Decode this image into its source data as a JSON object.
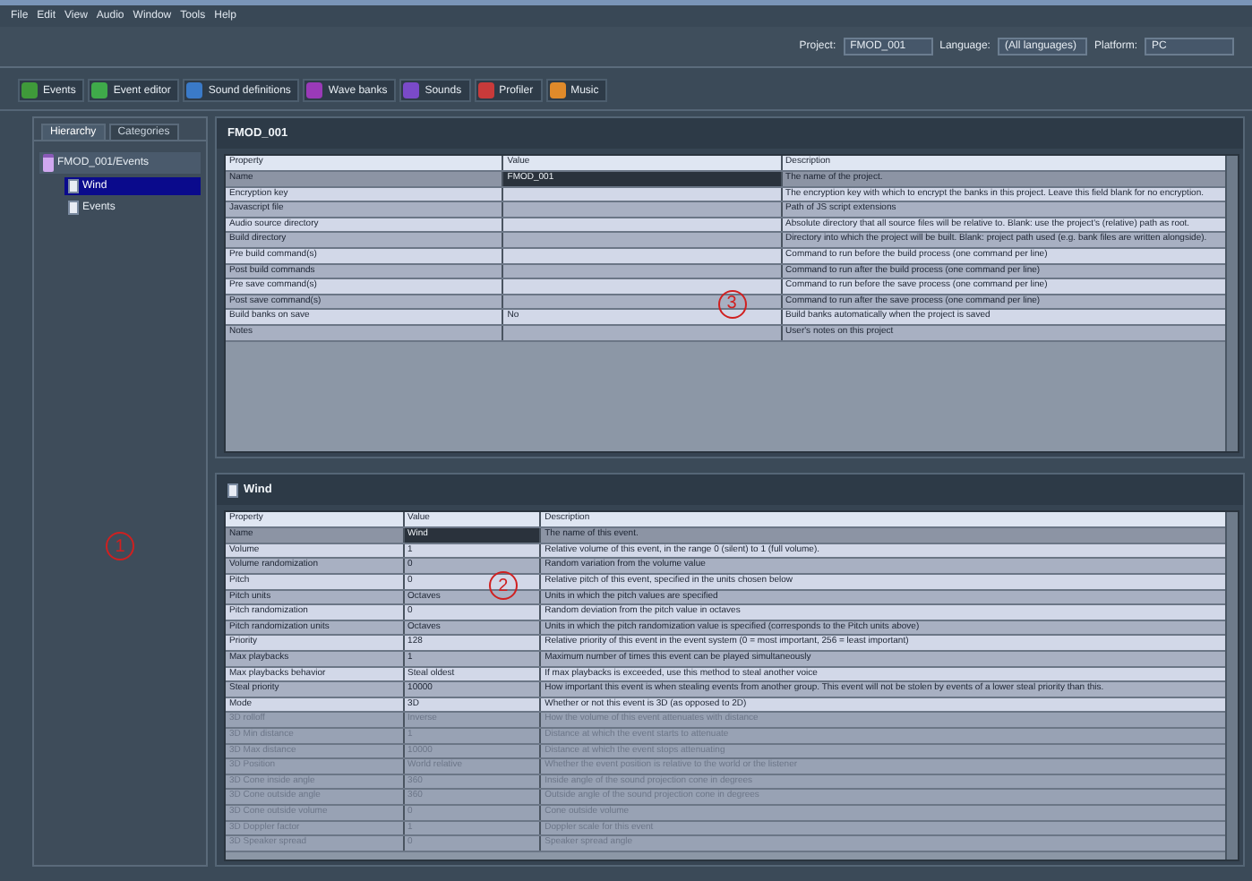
{
  "menu": [
    "File",
    "Edit",
    "View",
    "Audio",
    "Window",
    "Tools",
    "Help"
  ],
  "toolbar": {
    "tabs": [
      {
        "label": "Events",
        "color": "#3f9a3a",
        "selected": false
      },
      {
        "label": "Event editor",
        "color": "#3faa4a",
        "selected": false
      },
      {
        "label": "Sound definitions",
        "color": "#3a7ac8",
        "selected": false
      },
      {
        "label": "Wave banks",
        "color": "#9a3ab8",
        "selected": false
      },
      {
        "label": "Sounds",
        "color": "#7a4ac8",
        "selected": false
      },
      {
        "label": "Profiler",
        "color": "#c83a3a",
        "selected": false
      },
      {
        "label": "Music",
        "color": "#e08a2a",
        "selected": false
      }
    ],
    "project": {
      "label": "Project:",
      "value": "FMOD_001"
    },
    "language": {
      "label": "Language:",
      "value": "(All languages)"
    },
    "platform": {
      "label": "Platform:",
      "value": "PC"
    }
  },
  "sidebar": {
    "tabs": [
      {
        "label": "Hierarchy",
        "selected": true
      },
      {
        "label": "Categories",
        "selected": false
      }
    ],
    "tree": [
      {
        "label": "FMOD_001/Events",
        "expanded": true,
        "selected": false,
        "children": [
          {
            "label": "Wind",
            "selected": true
          },
          {
            "label": "Events",
            "selected": false
          }
        ]
      }
    ],
    "annotation": "1"
  },
  "project_panel": {
    "title": "FMOD_001",
    "annotation": "3",
    "columns": [
      "Property",
      "Value",
      "Description"
    ],
    "rows": [
      {
        "property": "Name",
        "value": "FMOD_001",
        "description": "The name of the project.",
        "selected": true
      },
      {
        "property": "Encryption key",
        "value": "",
        "description": "The encryption key with which to encrypt the banks in this project. Leave this field blank for no encryption.",
        "selected": false
      },
      {
        "property": "Javascript file",
        "value": "",
        "description": "Path of JS script extensions",
        "selected": false
      },
      {
        "property": "Audio source directory",
        "value": "",
        "description": "Absolute directory that all source files will be relative to. Blank: use the project's (relative) path as root.",
        "selected": false
      },
      {
        "property": "Build directory",
        "value": "",
        "description": "Directory into which the project will be built. Blank: project path used (e.g. bank files are written alongside).",
        "selected": false
      },
      {
        "property": "Pre build command(s)",
        "value": "",
        "description": "Command to run before the build process (one command per line)",
        "selected": false
      },
      {
        "property": "Post build commands",
        "value": "",
        "description": "Command to run after the build process (one command per line)",
        "selected": false
      },
      {
        "property": "Pre save command(s)",
        "value": "",
        "description": "Command to run before the save process (one command per line)",
        "selected": false
      },
      {
        "property": "Post save command(s)",
        "value": "",
        "description": "Command to run after the save process (one command per line)",
        "selected": false
      },
      {
        "property": "Build banks on save",
        "value": "No",
        "description": "Build banks automatically when the project is saved",
        "selected": false
      },
      {
        "property": "Notes",
        "value": "",
        "description": "User's notes on this project",
        "selected": false
      }
    ]
  },
  "event_panel": {
    "title": "Wind",
    "annotation": "2",
    "columns": [
      "Property",
      "Value",
      "Description"
    ],
    "rows": [
      {
        "property": "Name",
        "value": "Wind",
        "description": "The name of this event.",
        "selected": true,
        "disabled": false
      },
      {
        "property": "Volume",
        "value": "1",
        "description": "Relative volume of this event, in the range 0 (silent) to 1 (full volume).",
        "selected": false,
        "disabled": false
      },
      {
        "property": "Volume randomization",
        "value": "0",
        "description": "Random variation from the volume value",
        "selected": false,
        "disabled": false
      },
      {
        "property": "Pitch",
        "value": "0",
        "description": "Relative pitch of this event, specified in the units chosen below",
        "selected": false,
        "disabled": false
      },
      {
        "property": "Pitch units",
        "value": "Octaves",
        "description": "Units in which the pitch values are specified",
        "selected": false,
        "disabled": false
      },
      {
        "property": "Pitch randomization",
        "value": "0",
        "description": "Random deviation from the pitch value in octaves",
        "selected": false,
        "disabled": false
      },
      {
        "property": "Pitch randomization units",
        "value": "Octaves",
        "description": "Units in which the pitch randomization value is specified (corresponds to the Pitch units above)",
        "selected": false,
        "disabled": false
      },
      {
        "property": "Priority",
        "value": "128",
        "description": "Relative priority of this event in the event system (0 = most important, 256 = least important)",
        "selected": false,
        "disabled": false
      },
      {
        "property": "Max playbacks",
        "value": "1",
        "description": "Maximum number of times this event can be played simultaneously",
        "selected": false,
        "disabled": false
      },
      {
        "property": "Max playbacks behavior",
        "value": "Steal oldest",
        "description": "If max playbacks is exceeded, use this method to steal another voice",
        "selected": false,
        "disabled": false
      },
      {
        "property": "Steal priority",
        "value": "10000",
        "description": "How important this event is when stealing events from another group. This event will not be stolen by events of a lower steal priority than this.",
        "selected": false,
        "disabled": false
      },
      {
        "property": "Mode",
        "value": "3D",
        "description": "Whether or not this event is 3D (as opposed to 2D)",
        "selected": false,
        "disabled": false
      },
      {
        "property": "3D rolloff",
        "value": "Inverse",
        "description": "How the volume of this event attenuates with distance",
        "selected": false,
        "disabled": true
      },
      {
        "property": "3D Min distance",
        "value": "1",
        "description": "Distance at which the event starts to attenuate",
        "selected": false,
        "disabled": true
      },
      {
        "property": "3D Max distance",
        "value": "10000",
        "description": "Distance at which the event stops attenuating",
        "selected": false,
        "disabled": true
      },
      {
        "property": "3D Position",
        "value": "World relative",
        "description": "Whether the event position is relative to the world or the listener",
        "selected": false,
        "disabled": true
      },
      {
        "property": "3D Cone inside angle",
        "value": "360",
        "description": "Inside angle of the sound projection cone in degrees",
        "selected": false,
        "disabled": true
      },
      {
        "property": "3D Cone outside angle",
        "value": "360",
        "description": "Outside angle of the sound projection cone in degrees",
        "selected": false,
        "disabled": true
      },
      {
        "property": "3D Cone outside volume",
        "value": "0",
        "description": "Cone outside volume",
        "selected": false,
        "disabled": true
      },
      {
        "property": "3D Doppler factor",
        "value": "1",
        "description": "Doppler scale for this event",
        "selected": false,
        "disabled": true
      },
      {
        "property": "3D Speaker spread",
        "value": "0",
        "description": "Speaker spread angle",
        "selected": false,
        "disabled": true
      }
    ]
  }
}
